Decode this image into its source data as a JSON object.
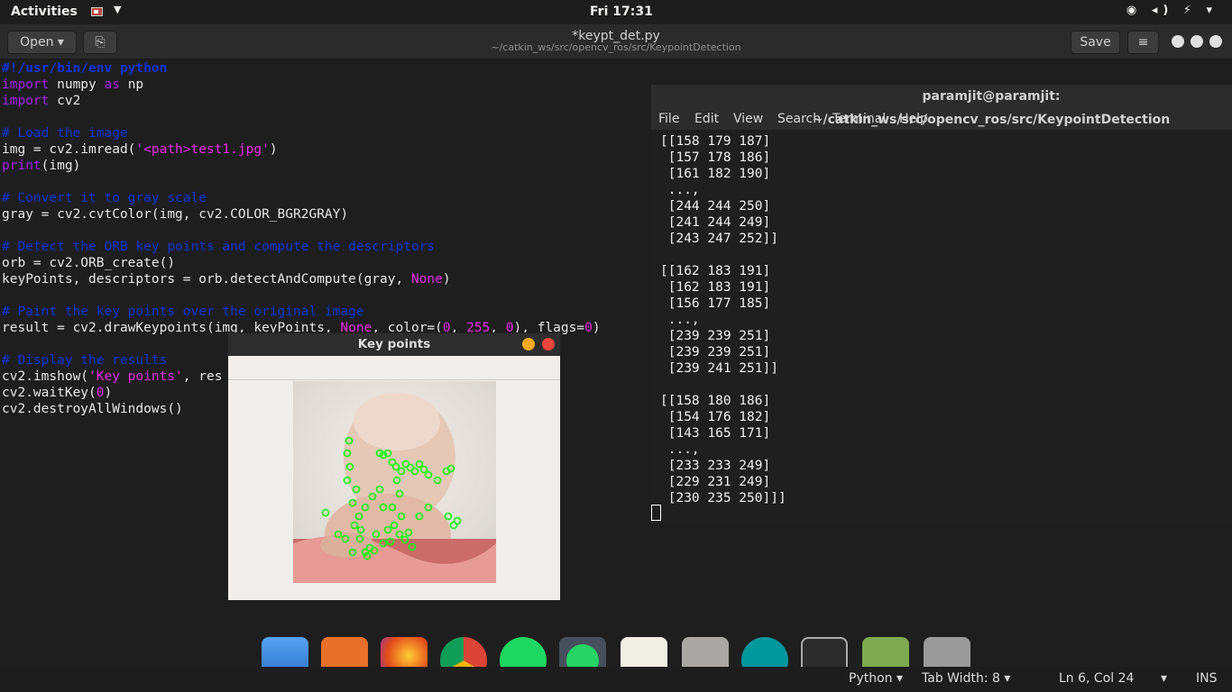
{
  "topbar": {
    "activities": "Activities",
    "arrow": "▼",
    "clock": "Fri 17:31",
    "tray": "◉ ◂) ⚡ ▾"
  },
  "header": {
    "open": "Open ▾",
    "pin": "⎘",
    "title": "*keypt_det.py",
    "path": "~/catkin_ws/src/opencv_ros/src/KeypointDetection",
    "save": "Save",
    "menu": "≡"
  },
  "code": {
    "l1": "#!/usr/bin/env python",
    "l2a": "import",
    "l2b": " numpy ",
    "l2c": "as",
    "l2d": " np",
    "l3a": "import",
    "l3b": " cv2",
    "l5": "# Load the image",
    "l6a": "img = cv2.imread(",
    "l6b": "'<path>test1.jpg'",
    "l6c": ")",
    "l7a": "print",
    "l7b": "(img)",
    "l9": "# Convert it to gray scale",
    "l10": "gray = cv2.cvtColor(img, cv2.COLOR_BGR2GRAY)",
    "l12": "# Detect the ORB key points and compute the descriptors",
    "l13": "orb = cv2.ORB_create()",
    "l14a": "keyPoints, descriptors = orb.detectAndCompute(gray, ",
    "l14b": "None",
    "l14c": ")",
    "l16": "# Paint the key points over the original image",
    "l17a": "result = cv2.drawKeypoints(img, keyPoints, ",
    "l17b": "None",
    "l17c": ", color=(",
    "l17d": "0",
    "l17e": ", ",
    "l17f": "255",
    "l17g": ", ",
    "l17h": "0",
    "l17i": "), flags=",
    "l17j": "0",
    "l17k": ")",
    "l19": "# Display the results",
    "l20a": "cv2.imshow(",
    "l20b": "'Key points'",
    "l20c": ", res",
    "l21a": "cv2.waitKey(",
    "l21b": "0",
    "l21c": ")",
    "l22": "cv2.destroyAllWindows()"
  },
  "keypoints_window": {
    "title": "Key points"
  },
  "terminal": {
    "title": "paramjit@paramjit: ~/catkin_ws/src/opencv_ros/src/KeypointDetection",
    "menu": [
      "File",
      "Edit",
      "View",
      "Search",
      "Terminal",
      "Help"
    ],
    "lines": [
      "[[158 179 187]",
      " [157 178 186]",
      " [161 182 190]",
      " ...,",
      " [244 244 250]",
      " [241 244 249]",
      " [243 247 252]]",
      "",
      "[[162 183 191]",
      " [162 183 191]",
      " [156 177 185]",
      " ...,",
      " [239 239 251]",
      " [239 239 251]",
      " [239 241 251]]",
      "",
      "[[158 180 186]",
      " [154 176 182]",
      " [143 165 171]",
      " ...,",
      " [233 233 249]",
      " [229 231 249]",
      " [230 235 250]]]"
    ]
  },
  "dock": [
    "files",
    "software-center",
    "firefox",
    "chrome",
    "spotify",
    "whatsapp",
    "text-editor",
    "file-cabinet",
    "arduino",
    "terminal",
    "system-monitor",
    "help"
  ],
  "status": {
    "lang": "Python ▾",
    "tab": "Tab Width: 8 ▾",
    "pos": "Ln 6, Col 24",
    "arrow": "▾",
    "ins": "INS"
  }
}
